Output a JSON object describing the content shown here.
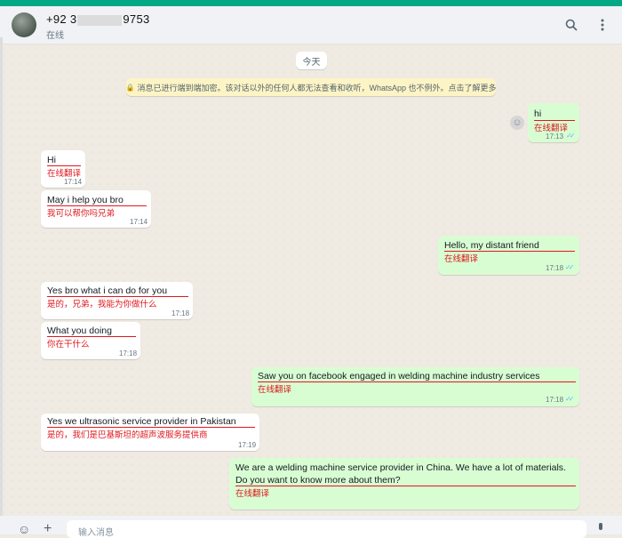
{
  "header": {
    "contact_prefix": "+92 3",
    "contact_suffix": "9753",
    "status": "在线",
    "search_icon": "search-icon",
    "menu_icon": "kebab-menu-icon"
  },
  "chat": {
    "date_chip": "今天",
    "encryption_notice": "消息已进行端到端加密。该对话以外的任何人都无法查看和收听，WhatsApp 也不例外。点击了解更多",
    "messages": [
      {
        "dir": "out",
        "text": "hi",
        "translation": "在线翻译",
        "time": "17:13",
        "read": true
      },
      {
        "dir": "in",
        "text": "Hi",
        "translation": "在线翻译",
        "time": "17:14"
      },
      {
        "dir": "in",
        "text": "May i help you bro",
        "translation": "我可以帮你吗兄弟",
        "time": "17:14"
      },
      {
        "dir": "out",
        "text": "Hello, my distant friend",
        "translation": "在线翻译",
        "time": "17:18",
        "read": true
      },
      {
        "dir": "in",
        "text": "Yes bro what i can do for you",
        "translation": "是的，兄弟，我能为你做什么",
        "time": "17:18"
      },
      {
        "dir": "in",
        "text": "What you doing",
        "translation": "你在干什么",
        "time": "17:18"
      },
      {
        "dir": "out",
        "text": "Saw you on facebook engaged in welding machine industry services",
        "translation": "在线翻译",
        "time": "17:18",
        "read": true
      },
      {
        "dir": "in",
        "text": "Yes we ultrasonic service provider in Pakistan",
        "translation": "是的，我们是巴基斯坦的超声波服务提供商",
        "time": "17:19"
      },
      {
        "dir": "out",
        "text_line1": "We are a welding machine service provider in China. We have a lot of materials.",
        "text_line2": "Do you want to know more about them?",
        "translation": "在线翻译"
      }
    ]
  },
  "compose": {
    "placeholder": "输入消息",
    "emoji_icon": "emoji-icon",
    "attach_icon": "plus-icon",
    "mic_icon": "mic-icon"
  },
  "colors": {
    "accent": "#00a884",
    "outgoing_bubble": "#d9fdd3",
    "incoming_bubble": "#ffffff",
    "translation_red": "#e0181f",
    "read_tick": "#53bdeb"
  }
}
